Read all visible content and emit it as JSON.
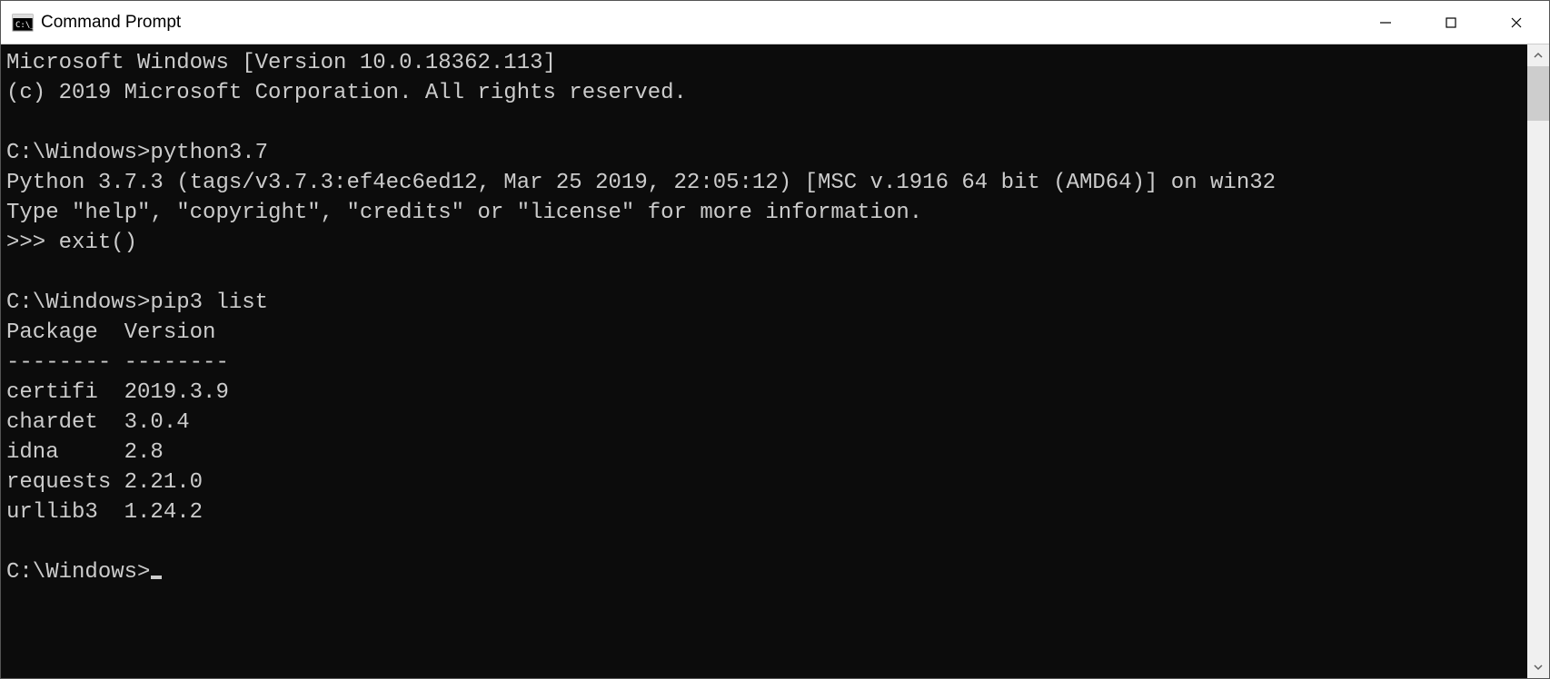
{
  "titlebar": {
    "title": "Command Prompt"
  },
  "terminal": {
    "lines": [
      "Microsoft Windows [Version 10.0.18362.113]",
      "(c) 2019 Microsoft Corporation. All rights reserved.",
      "",
      "C:\\Windows>python3.7",
      "Python 3.7.3 (tags/v3.7.3:ef4ec6ed12, Mar 25 2019, 22:05:12) [MSC v.1916 64 bit (AMD64)] on win32",
      "Type \"help\", \"copyright\", \"credits\" or \"license\" for more information.",
      ">>> exit()",
      "",
      "C:\\Windows>pip3 list",
      "Package  Version",
      "-------- --------",
      "certifi  2019.3.9",
      "chardet  3.0.4",
      "idna     2.8",
      "requests 2.21.0",
      "urllib3  1.24.2",
      "",
      "C:\\Windows>"
    ]
  }
}
